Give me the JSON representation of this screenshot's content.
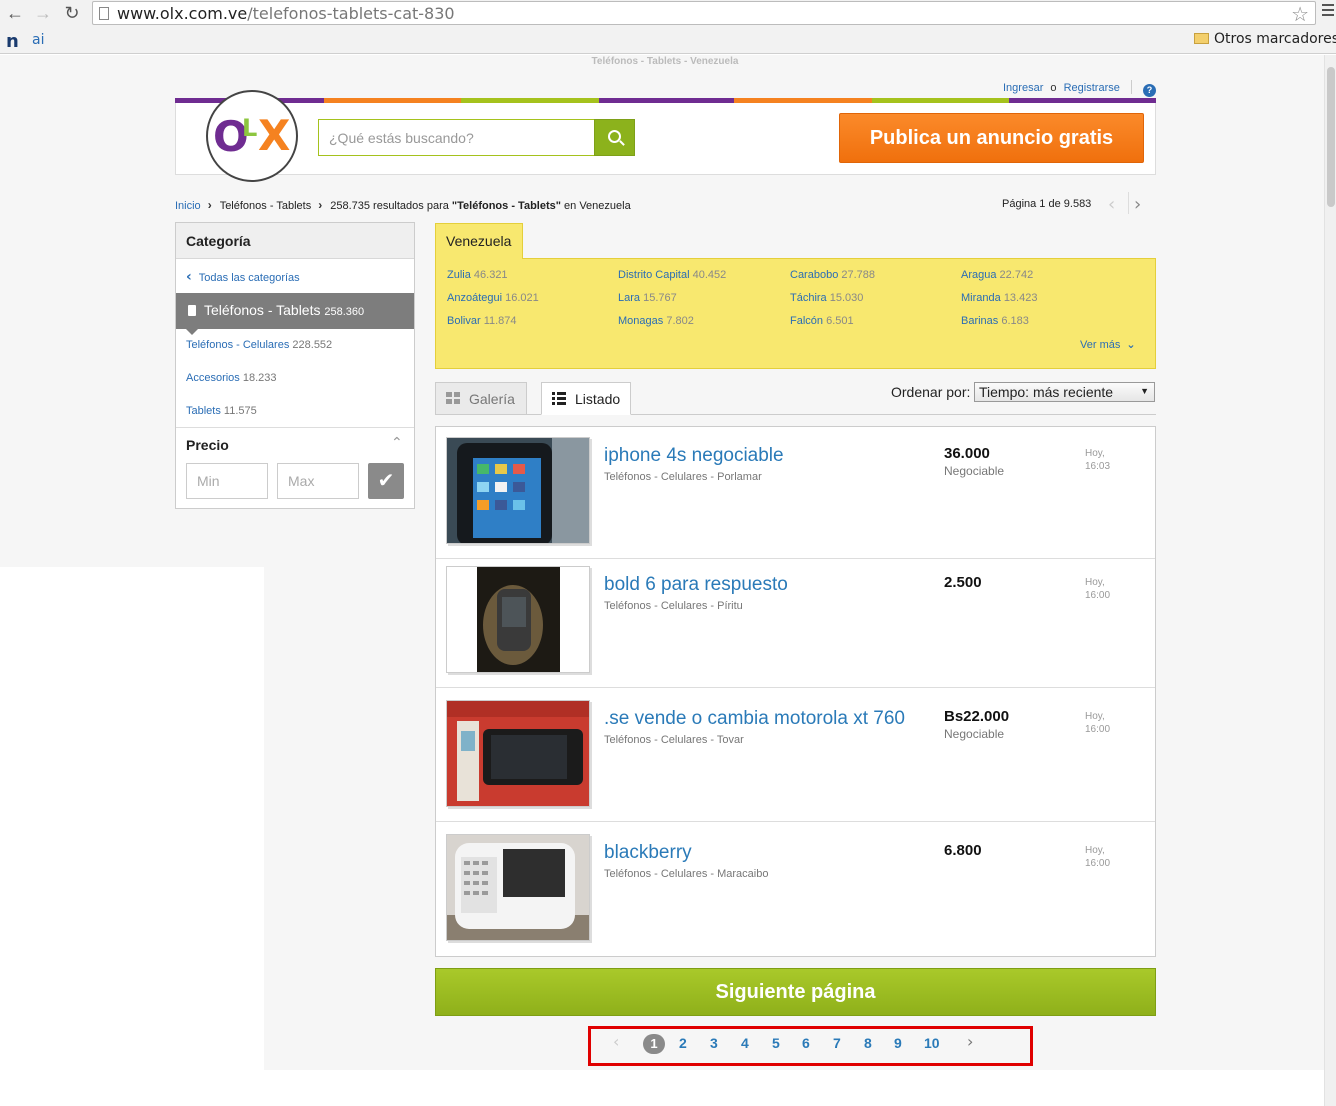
{
  "browser": {
    "url_domain": "www.olx.com.ve",
    "url_path": "/telefonos-tablets-cat-830",
    "bookmark_other": "Otros marcadores",
    "bookmark_icon1": "n",
    "bookmark_icon2": "ai"
  },
  "page": {
    "small_title": "Teléfonos - Tablets - Venezuela"
  },
  "header": {
    "login": "Ingresar",
    "or": "o",
    "register": "Registrarse",
    "help": "?",
    "logo": {
      "o": "O",
      "l": "L",
      "x": "X"
    },
    "search_placeholder": "¿Qué estás buscando?",
    "publish": "Publica un anuncio gratis",
    "colors": [
      "#6f2c91",
      "#f58220",
      "#8dc63f",
      "#6f2c91",
      "#f58220",
      "#8dc63f",
      "#6f2c91"
    ]
  },
  "breadcrumb": {
    "home": "Inicio",
    "category": "Teléfonos - Tablets",
    "results_prefix": "258.735 resultados para ",
    "results_query": "\"Teléfonos - Tablets\"",
    "results_suffix": " en Venezuela"
  },
  "pager_top": {
    "label": "Página 1 de 9.583"
  },
  "sidebar": {
    "heading": "Categoría",
    "all_categories": "Todas las categorías",
    "active": {
      "label": "Teléfonos - Tablets",
      "count": "258.360"
    },
    "items": [
      {
        "label": "Teléfonos - Celulares",
        "count": "228.552"
      },
      {
        "label": "Accesorios",
        "count": "18.233"
      },
      {
        "label": "Tablets",
        "count": "11.575"
      }
    ],
    "price_heading": "Precio",
    "min_placeholder": "Min",
    "max_placeholder": "Max"
  },
  "locations": {
    "tab": "Venezuela",
    "items": [
      {
        "name": "Zulia",
        "count": "46.321"
      },
      {
        "name": "Distrito Capital",
        "count": "40.452"
      },
      {
        "name": "Carabobo",
        "count": "27.788"
      },
      {
        "name": "Aragua",
        "count": "22.742"
      },
      {
        "name": "Anzoátegui",
        "count": "16.021"
      },
      {
        "name": "Lara",
        "count": "15.767"
      },
      {
        "name": "Táchira",
        "count": "15.030"
      },
      {
        "name": "Miranda",
        "count": "13.423"
      },
      {
        "name": "Bolivar",
        "count": "11.874"
      },
      {
        "name": "Monagas",
        "count": "7.802"
      },
      {
        "name": "Falcón",
        "count": "6.501"
      },
      {
        "name": "Barinas",
        "count": "6.183"
      }
    ],
    "more": "Ver más"
  },
  "view": {
    "gallery": "Galería",
    "list": "Listado",
    "order_label": "Ordenar por:",
    "order_value": "Tiempo: más reciente"
  },
  "listings": [
    {
      "title": "iphone 4s negociable",
      "sub": "Teléfonos - Celulares - Porlamar",
      "price": "36.000",
      "negotiable": "Negociable",
      "date1": "Hoy,",
      "date2": "16:03"
    },
    {
      "title": "bold 6 para respuesto",
      "sub": "Teléfonos - Celulares - Píritu",
      "price": "2.500",
      "negotiable": "",
      "date1": "Hoy,",
      "date2": "16:00"
    },
    {
      "title": ".se vende o cambia motorola xt 760",
      "sub": "Teléfonos - Celulares - Tovar",
      "price": "Bs22.000",
      "negotiable": "Negociable",
      "date1": "Hoy,",
      "date2": "16:00"
    },
    {
      "title": "blackberry",
      "sub": "Teléfonos - Celulares - Maracaibo",
      "price": "6.800",
      "negotiable": "",
      "date1": "Hoy,",
      "date2": "16:00"
    }
  ],
  "next_page": "Siguiente página",
  "pagination": {
    "current": "1",
    "pages": [
      "2",
      "3",
      "4",
      "5",
      "6",
      "7",
      "8",
      "9",
      "10"
    ]
  }
}
